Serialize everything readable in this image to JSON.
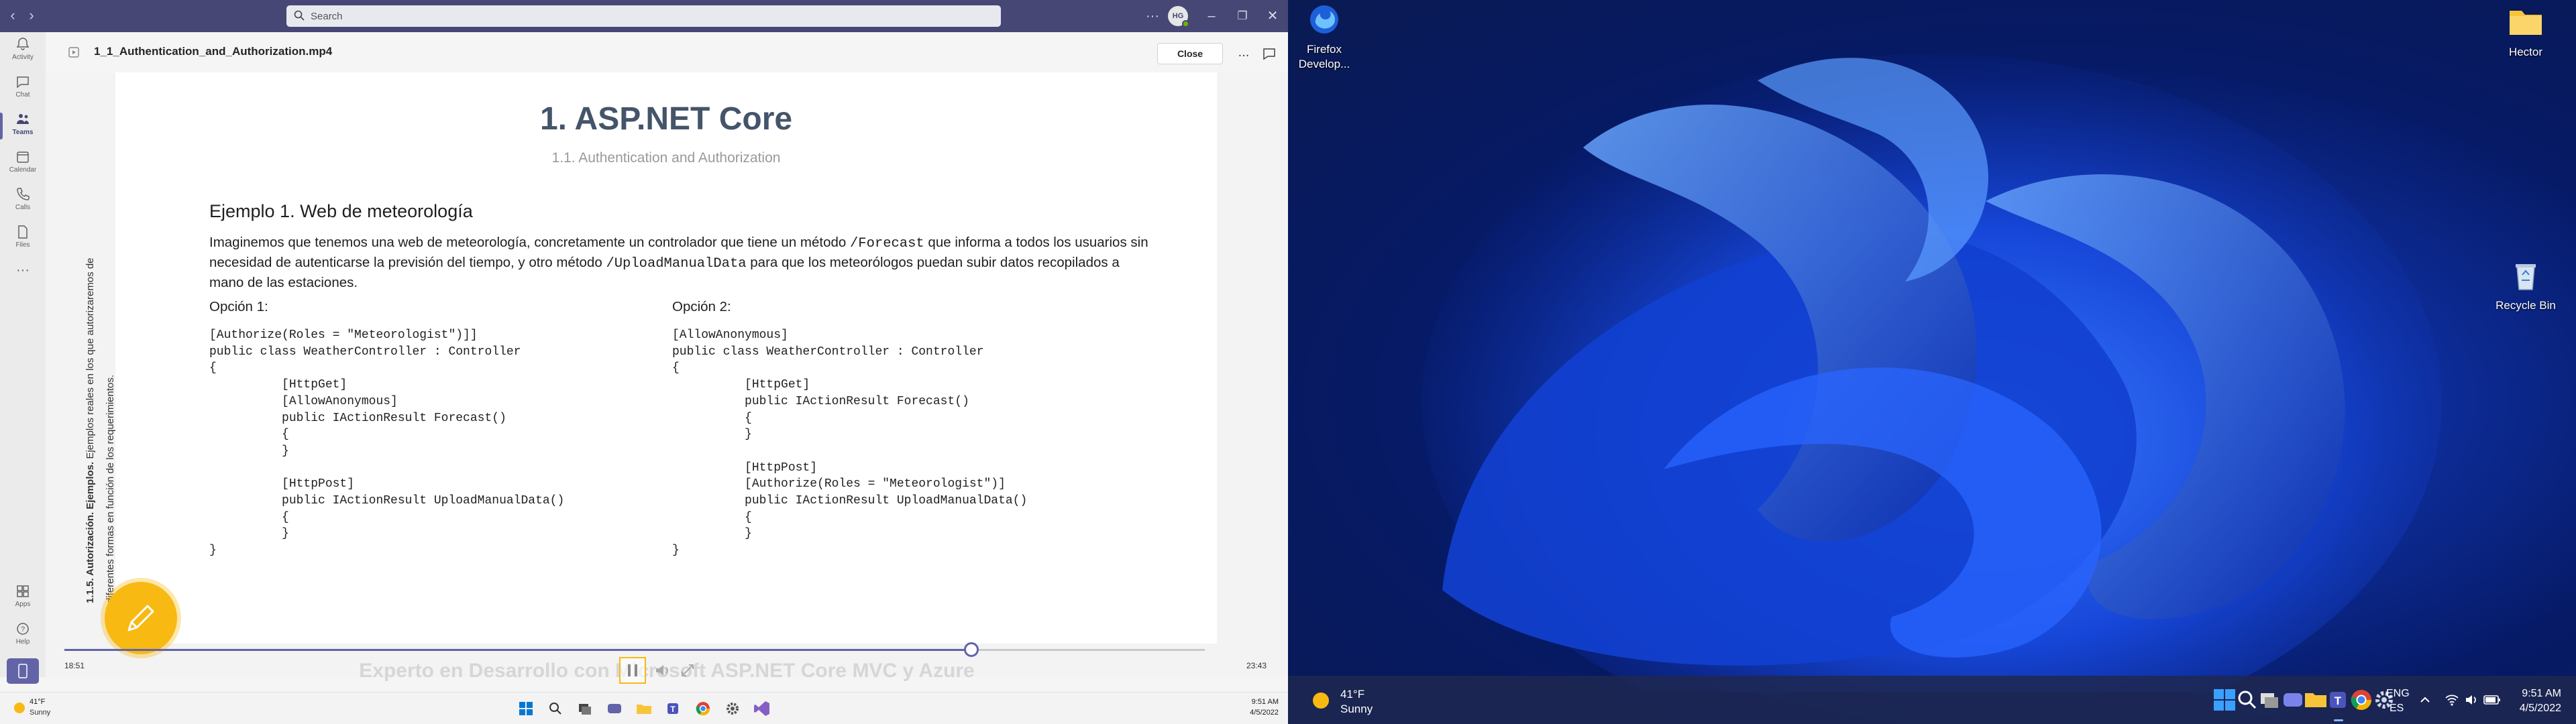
{
  "teams": {
    "search_placeholder": "Search",
    "avatar_initials": "HG",
    "rail": [
      {
        "label": "Activity",
        "icon": "bell-icon"
      },
      {
        "label": "Chat",
        "icon": "chat-icon"
      },
      {
        "label": "Teams",
        "icon": "teams-icon",
        "active": true
      },
      {
        "label": "Calendar",
        "icon": "calendar-icon"
      },
      {
        "label": "Calls",
        "icon": "phone-icon"
      },
      {
        "label": "Files",
        "icon": "file-icon"
      },
      {
        "label": "Apps",
        "icon": "apps-icon"
      },
      {
        "label": "Help",
        "icon": "help-icon"
      }
    ],
    "file_title": "1_1_Authentication_and_Authorization.mp4",
    "close_label": "Close",
    "more_label": "...",
    "accent_color": "#6264a7",
    "titlebar_color": "#464775"
  },
  "slide": {
    "title": "1. ASP.NET Core",
    "subtitle": "1.1. Authentication and Authorization",
    "side_bold": "1.1.5. Autorización. Ejemplos.",
    "side_text": "Ejemplos reales en los que autorizaremos de diferentes formas en función de los requerimientos.",
    "example_heading": "Ejemplo 1. Web de meteorología",
    "desc_part1": "Imaginemos que tenemos una web de meteorología, concretamente un controlador que tiene un método ",
    "desc_code1": "/Forecast",
    "desc_part2": " que informa a todos los usuarios sin necesidad de autenticarse la previsión del tiempo, y otro método ",
    "desc_code2": "/UploadManualData",
    "desc_part3": " para que los meteorólogos puedan subir datos recopilados a mano de las estaciones.",
    "option1_label": "Opción 1:",
    "option2_label": "Opción 2:",
    "option1_code": "[Authorize(Roles = \"Meteorologist\")]]\npublic class WeatherController : Controller\n{\n          [HttpGet]\n          [AllowAnonymous]\n          public IActionResult Forecast()\n          {\n          }\n\n          [HttpPost]\n          public IActionResult UploadManualData()\n          {\n          }\n}",
    "option2_code": "[AllowAnonymous]\npublic class WeatherController : Controller\n{\n          [HttpGet]\n          public IActionResult Forecast()\n          {\n          }\n\n          [HttpPost]\n          [Authorize(Roles = \"Meteorologist\")]\n          public IActionResult UploadManualData()\n          {\n          }\n}"
  },
  "player": {
    "time_current": "18:51",
    "time_total": "23:43",
    "progress_fraction": 0.795,
    "watermark": "Experto en Desarrollo con Microsoft ASP.NET Core MVC y Azure"
  },
  "taskbar_left": {
    "weather_temp": "41°F",
    "weather_cond": "Sunny",
    "time": "9:51 AM",
    "date": "4/5/2022"
  },
  "desktop": {
    "icons": [
      {
        "label1": "Firefox",
        "label2": "Develop...",
        "icon": "firefox-developer-icon"
      },
      {
        "label1": "Hector",
        "icon": "folder-icon"
      },
      {
        "label1": "Recycle Bin",
        "icon": "recycle-bin-icon"
      }
    ]
  },
  "taskbar_right": {
    "weather_temp": "41°F",
    "weather_cond": "Sunny",
    "lang1": "ENG",
    "lang2": "ES",
    "time": "9:51 AM",
    "date": "4/5/2022"
  }
}
